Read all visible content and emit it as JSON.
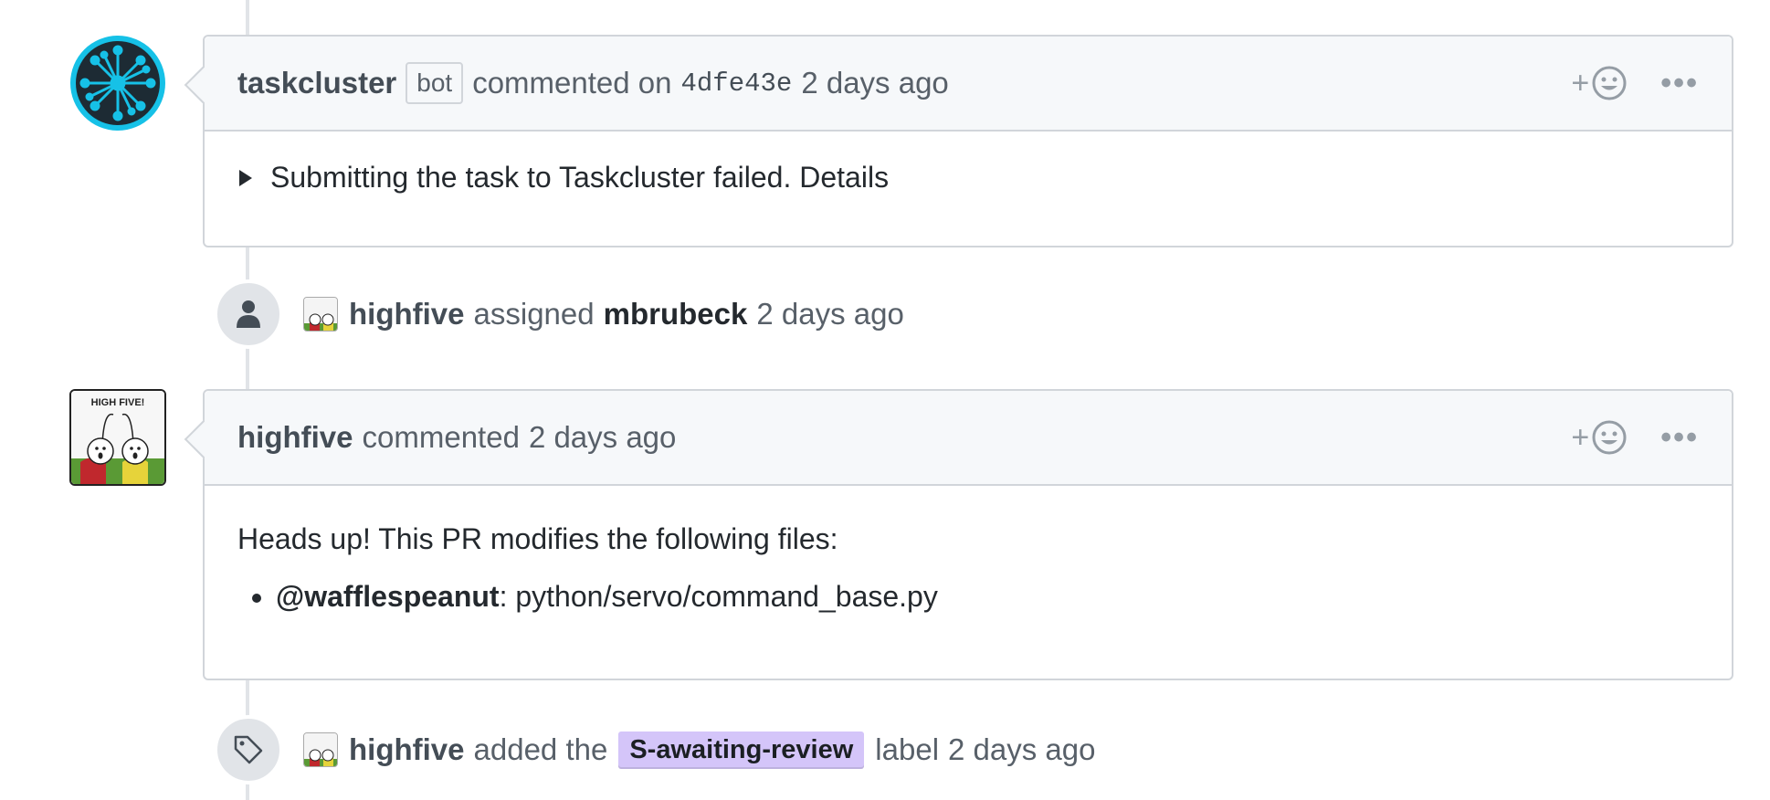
{
  "colors": {
    "label_bg": "#d4c5f9",
    "taskcluster_avatar_bg": "#16c1e7"
  },
  "comment1": {
    "author": "taskcluster",
    "badge": "bot",
    "action": "commented on",
    "commit": "4dfe43e",
    "time": "2 days ago",
    "details_summary": "Submitting the task to Taskcluster failed. Details",
    "icons": {
      "details": "triangle-right-icon",
      "reaction": "smiley-icon",
      "more": "kebab-icon"
    }
  },
  "event1": {
    "actor": "highfive",
    "action": "assigned",
    "target": "mbrubeck",
    "time": "2 days ago",
    "icon": "person-icon"
  },
  "comment2": {
    "author": "highfive",
    "action": "commented",
    "time": "2 days ago",
    "body_intro": "Heads up! This PR modifies the following files:",
    "files": [
      {
        "owner": "@wafflespeanut",
        "sep": ":",
        "path": "python/servo/command_base.py"
      }
    ],
    "avatar_text": "HIGH FIVE!"
  },
  "event2": {
    "actor": "highfive",
    "action": "added the",
    "label": "S-awaiting-review",
    "suffix": "label",
    "time": "2 days ago",
    "icon": "tag-icon"
  }
}
